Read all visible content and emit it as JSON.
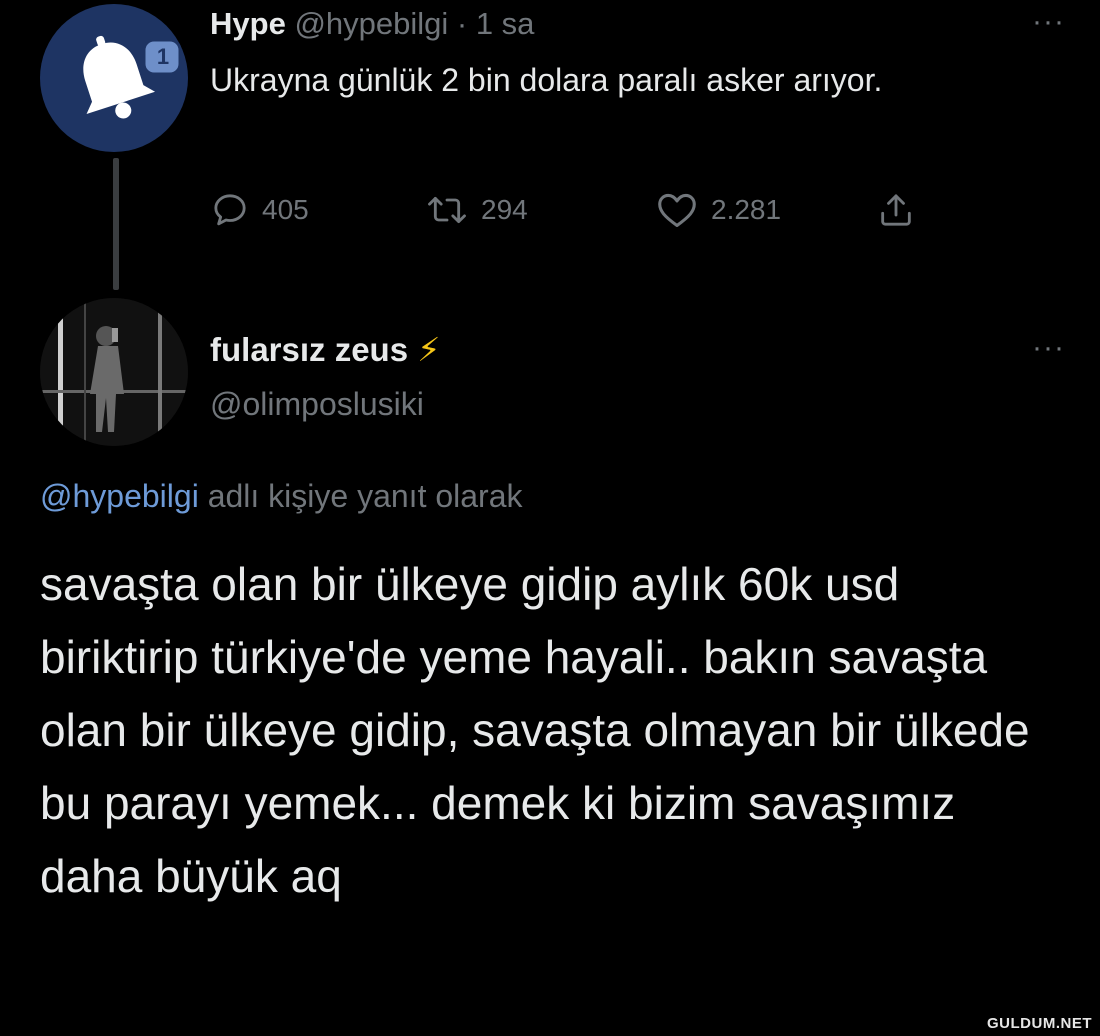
{
  "parent_tweet": {
    "author_name": "Hype",
    "handle_time": "@hypebilgi · 1 sa",
    "text": "Ukrayna günlük 2 bin dolara paralı asker arıyor.",
    "avatar_badge": "1",
    "more_label": "···",
    "actions": {
      "replies": "405",
      "retweets": "294",
      "likes": "2.281"
    }
  },
  "reply_tweet": {
    "author_name": "fularsız zeus",
    "author_emoji": "⚡",
    "handle": "@olimposlusiki",
    "more_label": "···",
    "replying_to": {
      "mention": "@hypebilgi",
      "suffix": " adlı kişiye yanıt olarak"
    },
    "text": "savaşta olan bir ülkeye gidip aylık 60k usd biriktirip türkiye'de yeme hayali.. bakın savaşta olan bir ülkeye gidip, savaşta olmayan bir ülkede bu parayı yemek... demek ki bizim savaşımız daha büyük aq"
  },
  "watermark": "GULDUM.NET",
  "colors": {
    "background": "#000000",
    "text_primary": "#e7e9ea",
    "text_secondary": "#71767b",
    "link": "#6e9bd8",
    "hype_avatar_bg": "#1e3463"
  }
}
